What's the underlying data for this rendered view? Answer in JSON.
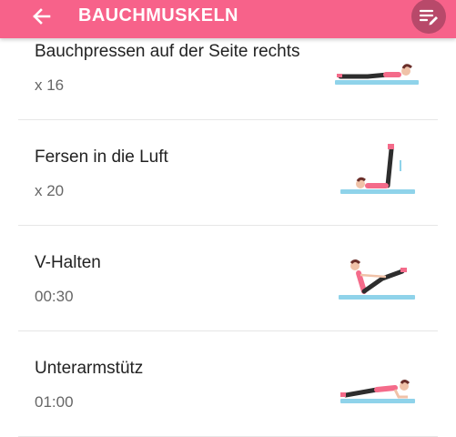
{
  "header": {
    "title": "BAUCHMUSKELN",
    "back_icon": "arrow-left-icon",
    "edit_icon": "playlist-edit-icon",
    "color": "#f7628a"
  },
  "exercises": [
    {
      "name": "Bauchpressen auf der Seite rechts",
      "amount": "x 16",
      "illustration": "side-crunch-right-icon"
    },
    {
      "name": "Fersen in die Luft",
      "amount": "x 20",
      "illustration": "heels-to-the-heaven-icon"
    },
    {
      "name": "V-Halten",
      "amount": "00:30",
      "illustration": "v-hold-icon"
    },
    {
      "name": "Unterarmstütz",
      "amount": "01:00",
      "illustration": "plank-icon"
    }
  ]
}
